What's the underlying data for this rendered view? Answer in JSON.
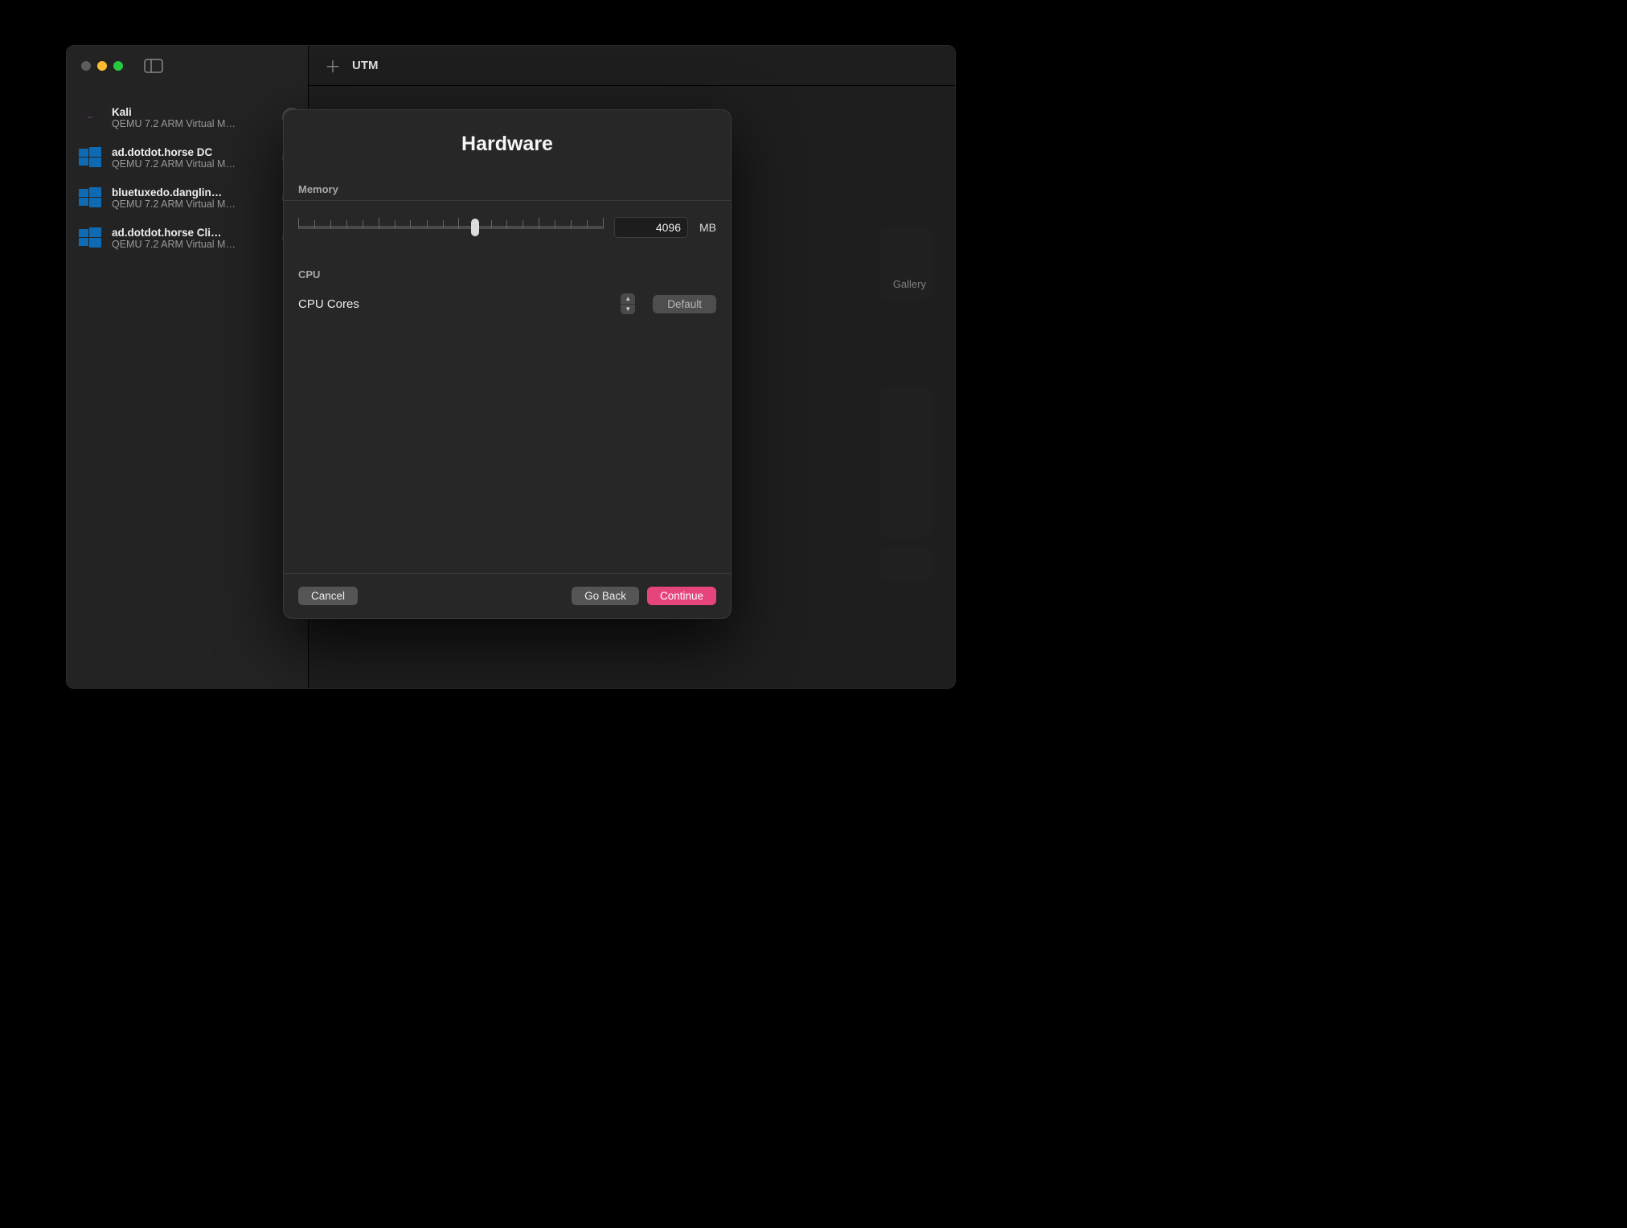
{
  "toolbar": {
    "app_title": "UTM"
  },
  "sidebar": {
    "items": [
      {
        "name": "Kali",
        "sub": "QEMU 7.2 ARM Virtual M…",
        "icon_type": "kali"
      },
      {
        "name": "ad.dotdot.horse DC",
        "sub": "QEMU 7.2 ARM Virtual M…",
        "icon_type": "windows"
      },
      {
        "name": "bluetuxedo.danglin…",
        "sub": "QEMU 7.2 ARM Virtual M…",
        "icon_type": "windows"
      },
      {
        "name": "ad.dotdot.horse Cli…",
        "sub": "QEMU 7.2 ARM Virtual M…",
        "icon_type": "windows"
      }
    ]
  },
  "modal": {
    "title": "Hardware",
    "memory_label": "Memory",
    "memory_value": "4096",
    "memory_unit": "MB",
    "cpu_label": "CPU",
    "cpu_cores_label": "CPU Cores",
    "default_button": "Default",
    "cancel": "Cancel",
    "goback": "Go Back",
    "continue": "Continue",
    "slider_position_pct": 58
  },
  "ghost_cards": {
    "gallery": "Gallery"
  },
  "colors": {
    "accent": "#e6447d",
    "windows_blue": "#0f6ab4"
  }
}
